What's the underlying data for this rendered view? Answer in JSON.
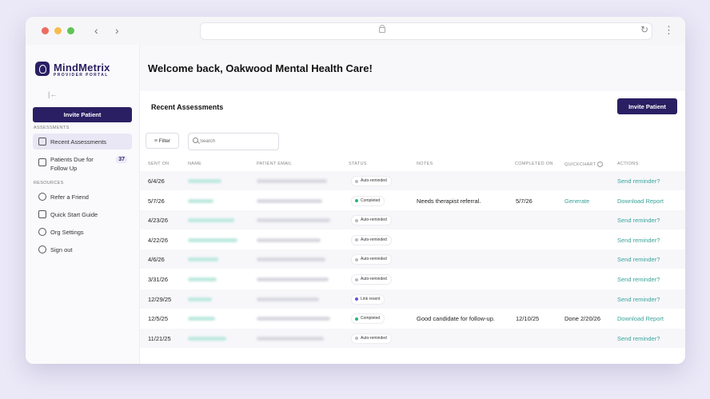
{
  "brand": {
    "name": "MindMetrix",
    "subtitle": "PROVIDER PORTAL"
  },
  "browser": {
    "back": "‹",
    "forward": "›",
    "reload": "↻",
    "more": "⋮",
    "collapse": "|←"
  },
  "sidebar": {
    "invite_label": "Invite Patient",
    "assessments_label": "ASSESSMENTS",
    "resources_label": "RESOURCES",
    "items": [
      {
        "label": "Recent Assessments",
        "icon": "home-icon"
      },
      {
        "label": "Patients Due for Follow Up",
        "badge": "37",
        "icon": "calendar-icon"
      },
      {
        "label": "Refer a Friend",
        "icon": "user-icon"
      },
      {
        "label": "Quick Start Guide",
        "icon": "book-icon"
      },
      {
        "label": "Org Settings",
        "icon": "gear-icon"
      },
      {
        "label": "Sign out",
        "icon": "info-icon"
      }
    ]
  },
  "main": {
    "welcome": "Welcome back, Oakwood Mental Health Care!",
    "panel_title": "Recent Assessments",
    "invite_label": "Invite Patient",
    "filter_label": "Filter",
    "search_placeholder": "Search"
  },
  "table": {
    "headers": [
      "SENT ON",
      "NAME",
      "PATIENT EMAIL",
      "STATUS",
      "NOTES",
      "COMPLETED ON",
      "QUICKCHART",
      "ACTIONS"
    ],
    "rows": [
      {
        "sent": "6/4/26",
        "status": "Auto-reminded",
        "notes": "",
        "completed": "",
        "quickchart": "",
        "action": "Send reminder?"
      },
      {
        "sent": "5/7/26",
        "status": "Completed",
        "notes": "Needs therapist referral.",
        "completed": "5/7/26",
        "quickchart": "Generate",
        "action": "Download Report"
      },
      {
        "sent": "4/23/26",
        "status": "Auto-reminded",
        "notes": "",
        "completed": "",
        "quickchart": "",
        "action": "Send reminder?"
      },
      {
        "sent": "4/22/26",
        "status": "Auto-reminded",
        "notes": "",
        "completed": "",
        "quickchart": "",
        "action": "Send reminder?"
      },
      {
        "sent": "4/6/26",
        "status": "Auto-reminded",
        "notes": "",
        "completed": "",
        "quickchart": "",
        "action": "Send reminder?"
      },
      {
        "sent": "3/31/26",
        "status": "Auto-reminded",
        "notes": "",
        "completed": "",
        "quickchart": "",
        "action": "Send reminder?"
      },
      {
        "sent": "12/29/25",
        "status": "Link resent",
        "notes": "",
        "completed": "",
        "quickchart": "",
        "action": "Send reminder?"
      },
      {
        "sent": "12/5/25",
        "status": "Completed",
        "notes": "Good candidate for follow-up.",
        "completed": "12/10/25",
        "quickchart": "Done 2/20/26",
        "action": "Download Report"
      },
      {
        "sent": "11/21/25",
        "status": "Auto-reminded",
        "notes": "",
        "completed": "",
        "quickchart": "",
        "action": "Send reminder?"
      }
    ]
  },
  "colors": {
    "brand": "#2a1f63",
    "link": "#3aa39a",
    "status_auto": "#b9b9c4",
    "status_completed": "#2fb37a",
    "status_resent": "#6b4fd8"
  }
}
